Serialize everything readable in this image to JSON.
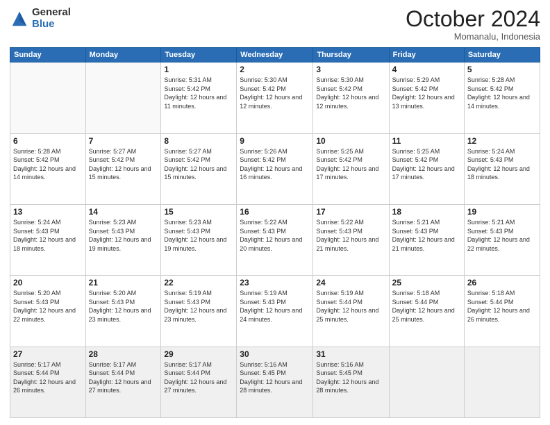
{
  "logo": {
    "general": "General",
    "blue": "Blue"
  },
  "header": {
    "month": "October 2024",
    "location": "Momanalu, Indonesia"
  },
  "weekdays": [
    "Sunday",
    "Monday",
    "Tuesday",
    "Wednesday",
    "Thursday",
    "Friday",
    "Saturday"
  ],
  "weeks": [
    [
      {
        "day": "",
        "sunrise": "",
        "sunset": "",
        "daylight": ""
      },
      {
        "day": "",
        "sunrise": "",
        "sunset": "",
        "daylight": ""
      },
      {
        "day": "1",
        "sunrise": "Sunrise: 5:31 AM",
        "sunset": "Sunset: 5:42 PM",
        "daylight": "Daylight: 12 hours and 11 minutes."
      },
      {
        "day": "2",
        "sunrise": "Sunrise: 5:30 AM",
        "sunset": "Sunset: 5:42 PM",
        "daylight": "Daylight: 12 hours and 12 minutes."
      },
      {
        "day": "3",
        "sunrise": "Sunrise: 5:30 AM",
        "sunset": "Sunset: 5:42 PM",
        "daylight": "Daylight: 12 hours and 12 minutes."
      },
      {
        "day": "4",
        "sunrise": "Sunrise: 5:29 AM",
        "sunset": "Sunset: 5:42 PM",
        "daylight": "Daylight: 12 hours and 13 minutes."
      },
      {
        "day": "5",
        "sunrise": "Sunrise: 5:28 AM",
        "sunset": "Sunset: 5:42 PM",
        "daylight": "Daylight: 12 hours and 14 minutes."
      }
    ],
    [
      {
        "day": "6",
        "sunrise": "Sunrise: 5:28 AM",
        "sunset": "Sunset: 5:42 PM",
        "daylight": "Daylight: 12 hours and 14 minutes."
      },
      {
        "day": "7",
        "sunrise": "Sunrise: 5:27 AM",
        "sunset": "Sunset: 5:42 PM",
        "daylight": "Daylight: 12 hours and 15 minutes."
      },
      {
        "day": "8",
        "sunrise": "Sunrise: 5:27 AM",
        "sunset": "Sunset: 5:42 PM",
        "daylight": "Daylight: 12 hours and 15 minutes."
      },
      {
        "day": "9",
        "sunrise": "Sunrise: 5:26 AM",
        "sunset": "Sunset: 5:42 PM",
        "daylight": "Daylight: 12 hours and 16 minutes."
      },
      {
        "day": "10",
        "sunrise": "Sunrise: 5:25 AM",
        "sunset": "Sunset: 5:42 PM",
        "daylight": "Daylight: 12 hours and 17 minutes."
      },
      {
        "day": "11",
        "sunrise": "Sunrise: 5:25 AM",
        "sunset": "Sunset: 5:42 PM",
        "daylight": "Daylight: 12 hours and 17 minutes."
      },
      {
        "day": "12",
        "sunrise": "Sunrise: 5:24 AM",
        "sunset": "Sunset: 5:43 PM",
        "daylight": "Daylight: 12 hours and 18 minutes."
      }
    ],
    [
      {
        "day": "13",
        "sunrise": "Sunrise: 5:24 AM",
        "sunset": "Sunset: 5:43 PM",
        "daylight": "Daylight: 12 hours and 18 minutes."
      },
      {
        "day": "14",
        "sunrise": "Sunrise: 5:23 AM",
        "sunset": "Sunset: 5:43 PM",
        "daylight": "Daylight: 12 hours and 19 minutes."
      },
      {
        "day": "15",
        "sunrise": "Sunrise: 5:23 AM",
        "sunset": "Sunset: 5:43 PM",
        "daylight": "Daylight: 12 hours and 19 minutes."
      },
      {
        "day": "16",
        "sunrise": "Sunrise: 5:22 AM",
        "sunset": "Sunset: 5:43 PM",
        "daylight": "Daylight: 12 hours and 20 minutes."
      },
      {
        "day": "17",
        "sunrise": "Sunrise: 5:22 AM",
        "sunset": "Sunset: 5:43 PM",
        "daylight": "Daylight: 12 hours and 21 minutes."
      },
      {
        "day": "18",
        "sunrise": "Sunrise: 5:21 AM",
        "sunset": "Sunset: 5:43 PM",
        "daylight": "Daylight: 12 hours and 21 minutes."
      },
      {
        "day": "19",
        "sunrise": "Sunrise: 5:21 AM",
        "sunset": "Sunset: 5:43 PM",
        "daylight": "Daylight: 12 hours and 22 minutes."
      }
    ],
    [
      {
        "day": "20",
        "sunrise": "Sunrise: 5:20 AM",
        "sunset": "Sunset: 5:43 PM",
        "daylight": "Daylight: 12 hours and 22 minutes."
      },
      {
        "day": "21",
        "sunrise": "Sunrise: 5:20 AM",
        "sunset": "Sunset: 5:43 PM",
        "daylight": "Daylight: 12 hours and 23 minutes."
      },
      {
        "day": "22",
        "sunrise": "Sunrise: 5:19 AM",
        "sunset": "Sunset: 5:43 PM",
        "daylight": "Daylight: 12 hours and 23 minutes."
      },
      {
        "day": "23",
        "sunrise": "Sunrise: 5:19 AM",
        "sunset": "Sunset: 5:43 PM",
        "daylight": "Daylight: 12 hours and 24 minutes."
      },
      {
        "day": "24",
        "sunrise": "Sunrise: 5:19 AM",
        "sunset": "Sunset: 5:44 PM",
        "daylight": "Daylight: 12 hours and 25 minutes."
      },
      {
        "day": "25",
        "sunrise": "Sunrise: 5:18 AM",
        "sunset": "Sunset: 5:44 PM",
        "daylight": "Daylight: 12 hours and 25 minutes."
      },
      {
        "day": "26",
        "sunrise": "Sunrise: 5:18 AM",
        "sunset": "Sunset: 5:44 PM",
        "daylight": "Daylight: 12 hours and 26 minutes."
      }
    ],
    [
      {
        "day": "27",
        "sunrise": "Sunrise: 5:17 AM",
        "sunset": "Sunset: 5:44 PM",
        "daylight": "Daylight: 12 hours and 26 minutes."
      },
      {
        "day": "28",
        "sunrise": "Sunrise: 5:17 AM",
        "sunset": "Sunset: 5:44 PM",
        "daylight": "Daylight: 12 hours and 27 minutes."
      },
      {
        "day": "29",
        "sunrise": "Sunrise: 5:17 AM",
        "sunset": "Sunset: 5:44 PM",
        "daylight": "Daylight: 12 hours and 27 minutes."
      },
      {
        "day": "30",
        "sunrise": "Sunrise: 5:16 AM",
        "sunset": "Sunset: 5:45 PM",
        "daylight": "Daylight: 12 hours and 28 minutes."
      },
      {
        "day": "31",
        "sunrise": "Sunrise: 5:16 AM",
        "sunset": "Sunset: 5:45 PM",
        "daylight": "Daylight: 12 hours and 28 minutes."
      },
      {
        "day": "",
        "sunrise": "",
        "sunset": "",
        "daylight": ""
      },
      {
        "day": "",
        "sunrise": "",
        "sunset": "",
        "daylight": ""
      }
    ]
  ]
}
